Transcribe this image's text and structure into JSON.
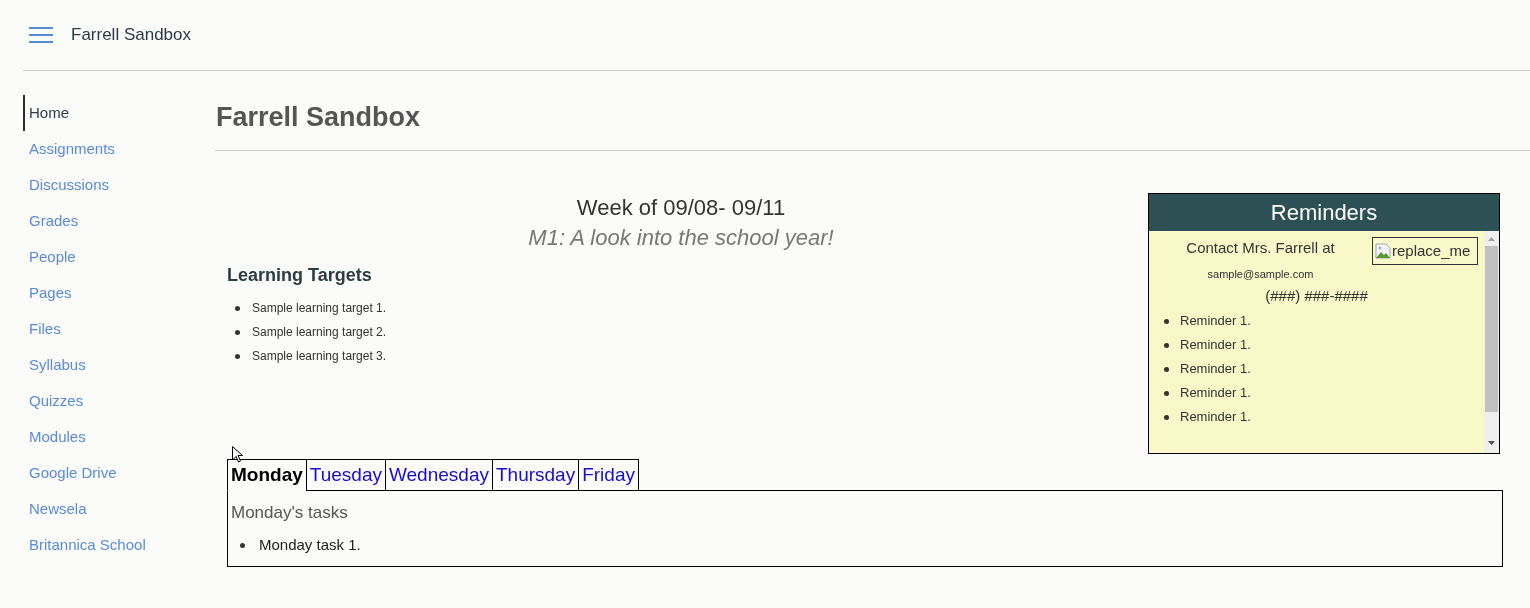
{
  "header": {
    "title": "Farrell Sandbox"
  },
  "sidebar": {
    "items": [
      {
        "label": "Home",
        "selected": true
      },
      {
        "label": "Assignments",
        "selected": false
      },
      {
        "label": "Discussions",
        "selected": false
      },
      {
        "label": "Grades",
        "selected": false
      },
      {
        "label": "People",
        "selected": false
      },
      {
        "label": "Pages",
        "selected": false
      },
      {
        "label": "Files",
        "selected": false
      },
      {
        "label": "Syllabus",
        "selected": false
      },
      {
        "label": "Quizzes",
        "selected": false
      },
      {
        "label": "Modules",
        "selected": false
      },
      {
        "label": "Google Drive",
        "selected": false
      },
      {
        "label": "Newsela",
        "selected": false
      },
      {
        "label": "Britannica School",
        "selected": false
      }
    ]
  },
  "page": {
    "title": "Farrell Sandbox"
  },
  "week": {
    "heading": "Week of 09/08- 09/11",
    "subtitle": "M1: A look into the school year!"
  },
  "learning_targets": {
    "heading": "Learning Targets",
    "items": [
      "Sample learning target 1.",
      "Sample learning target 2.",
      "Sample learning target 3."
    ]
  },
  "reminders": {
    "title": "Reminders",
    "contact": "Contact Mrs. Farrell at",
    "email": "sample@sample.com",
    "image_alt": "replace_me",
    "phone": "(###) ###-####",
    "items": [
      "Reminder 1.",
      "Reminder 1.",
      "Reminder 1.",
      "Reminder 1.",
      "Reminder 1."
    ]
  },
  "day_tabs": {
    "tabs": [
      {
        "label": "Monday",
        "selected": true
      },
      {
        "label": "Tuesday",
        "selected": false
      },
      {
        "label": "Wednesday",
        "selected": false
      },
      {
        "label": "Thursday",
        "selected": false
      },
      {
        "label": "Friday",
        "selected": false
      }
    ],
    "panel": {
      "heading": "Monday's tasks",
      "items": [
        "Monday task 1."
      ]
    }
  }
}
